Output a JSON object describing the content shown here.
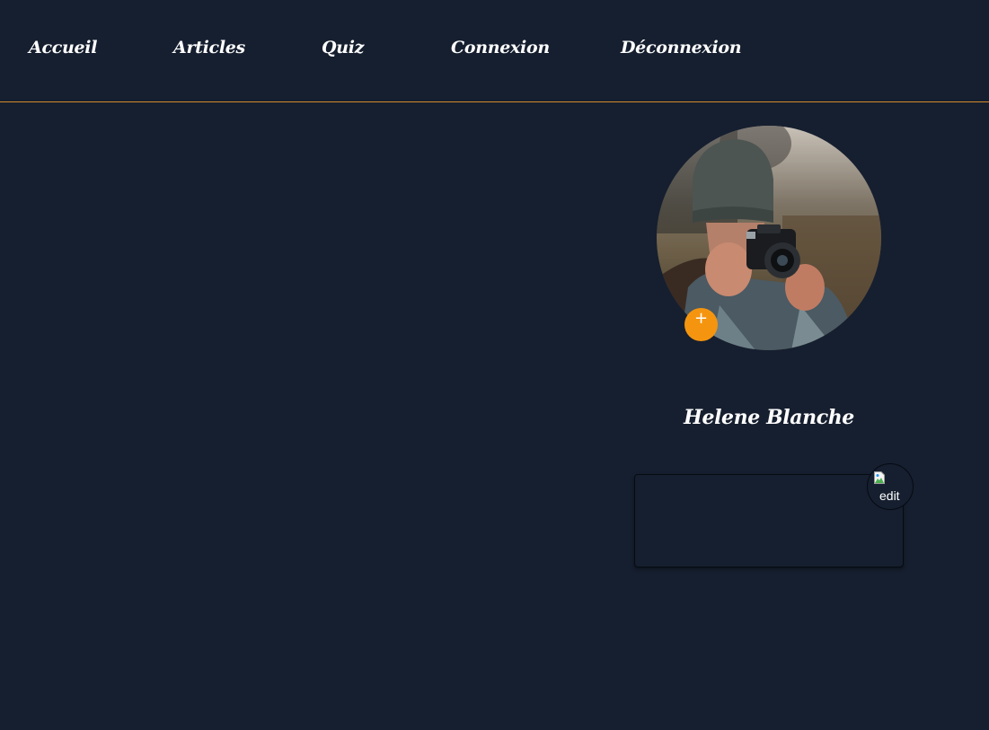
{
  "nav": {
    "links": [
      {
        "label": "Accueil"
      },
      {
        "label": "Articles"
      },
      {
        "label": "Quiz"
      },
      {
        "label": "Connexion"
      },
      {
        "label": "Déconnexion"
      }
    ]
  },
  "profile": {
    "photo_icon": "camera-person-photo",
    "add_photo_label": "+",
    "name": "Helene Blanche",
    "bio_text": "",
    "edit_button_alt": "edit"
  },
  "colors": {
    "background": "#161f2f",
    "accent": "#f5950f",
    "divider": "#d48a2a",
    "text": "#ffffff"
  }
}
